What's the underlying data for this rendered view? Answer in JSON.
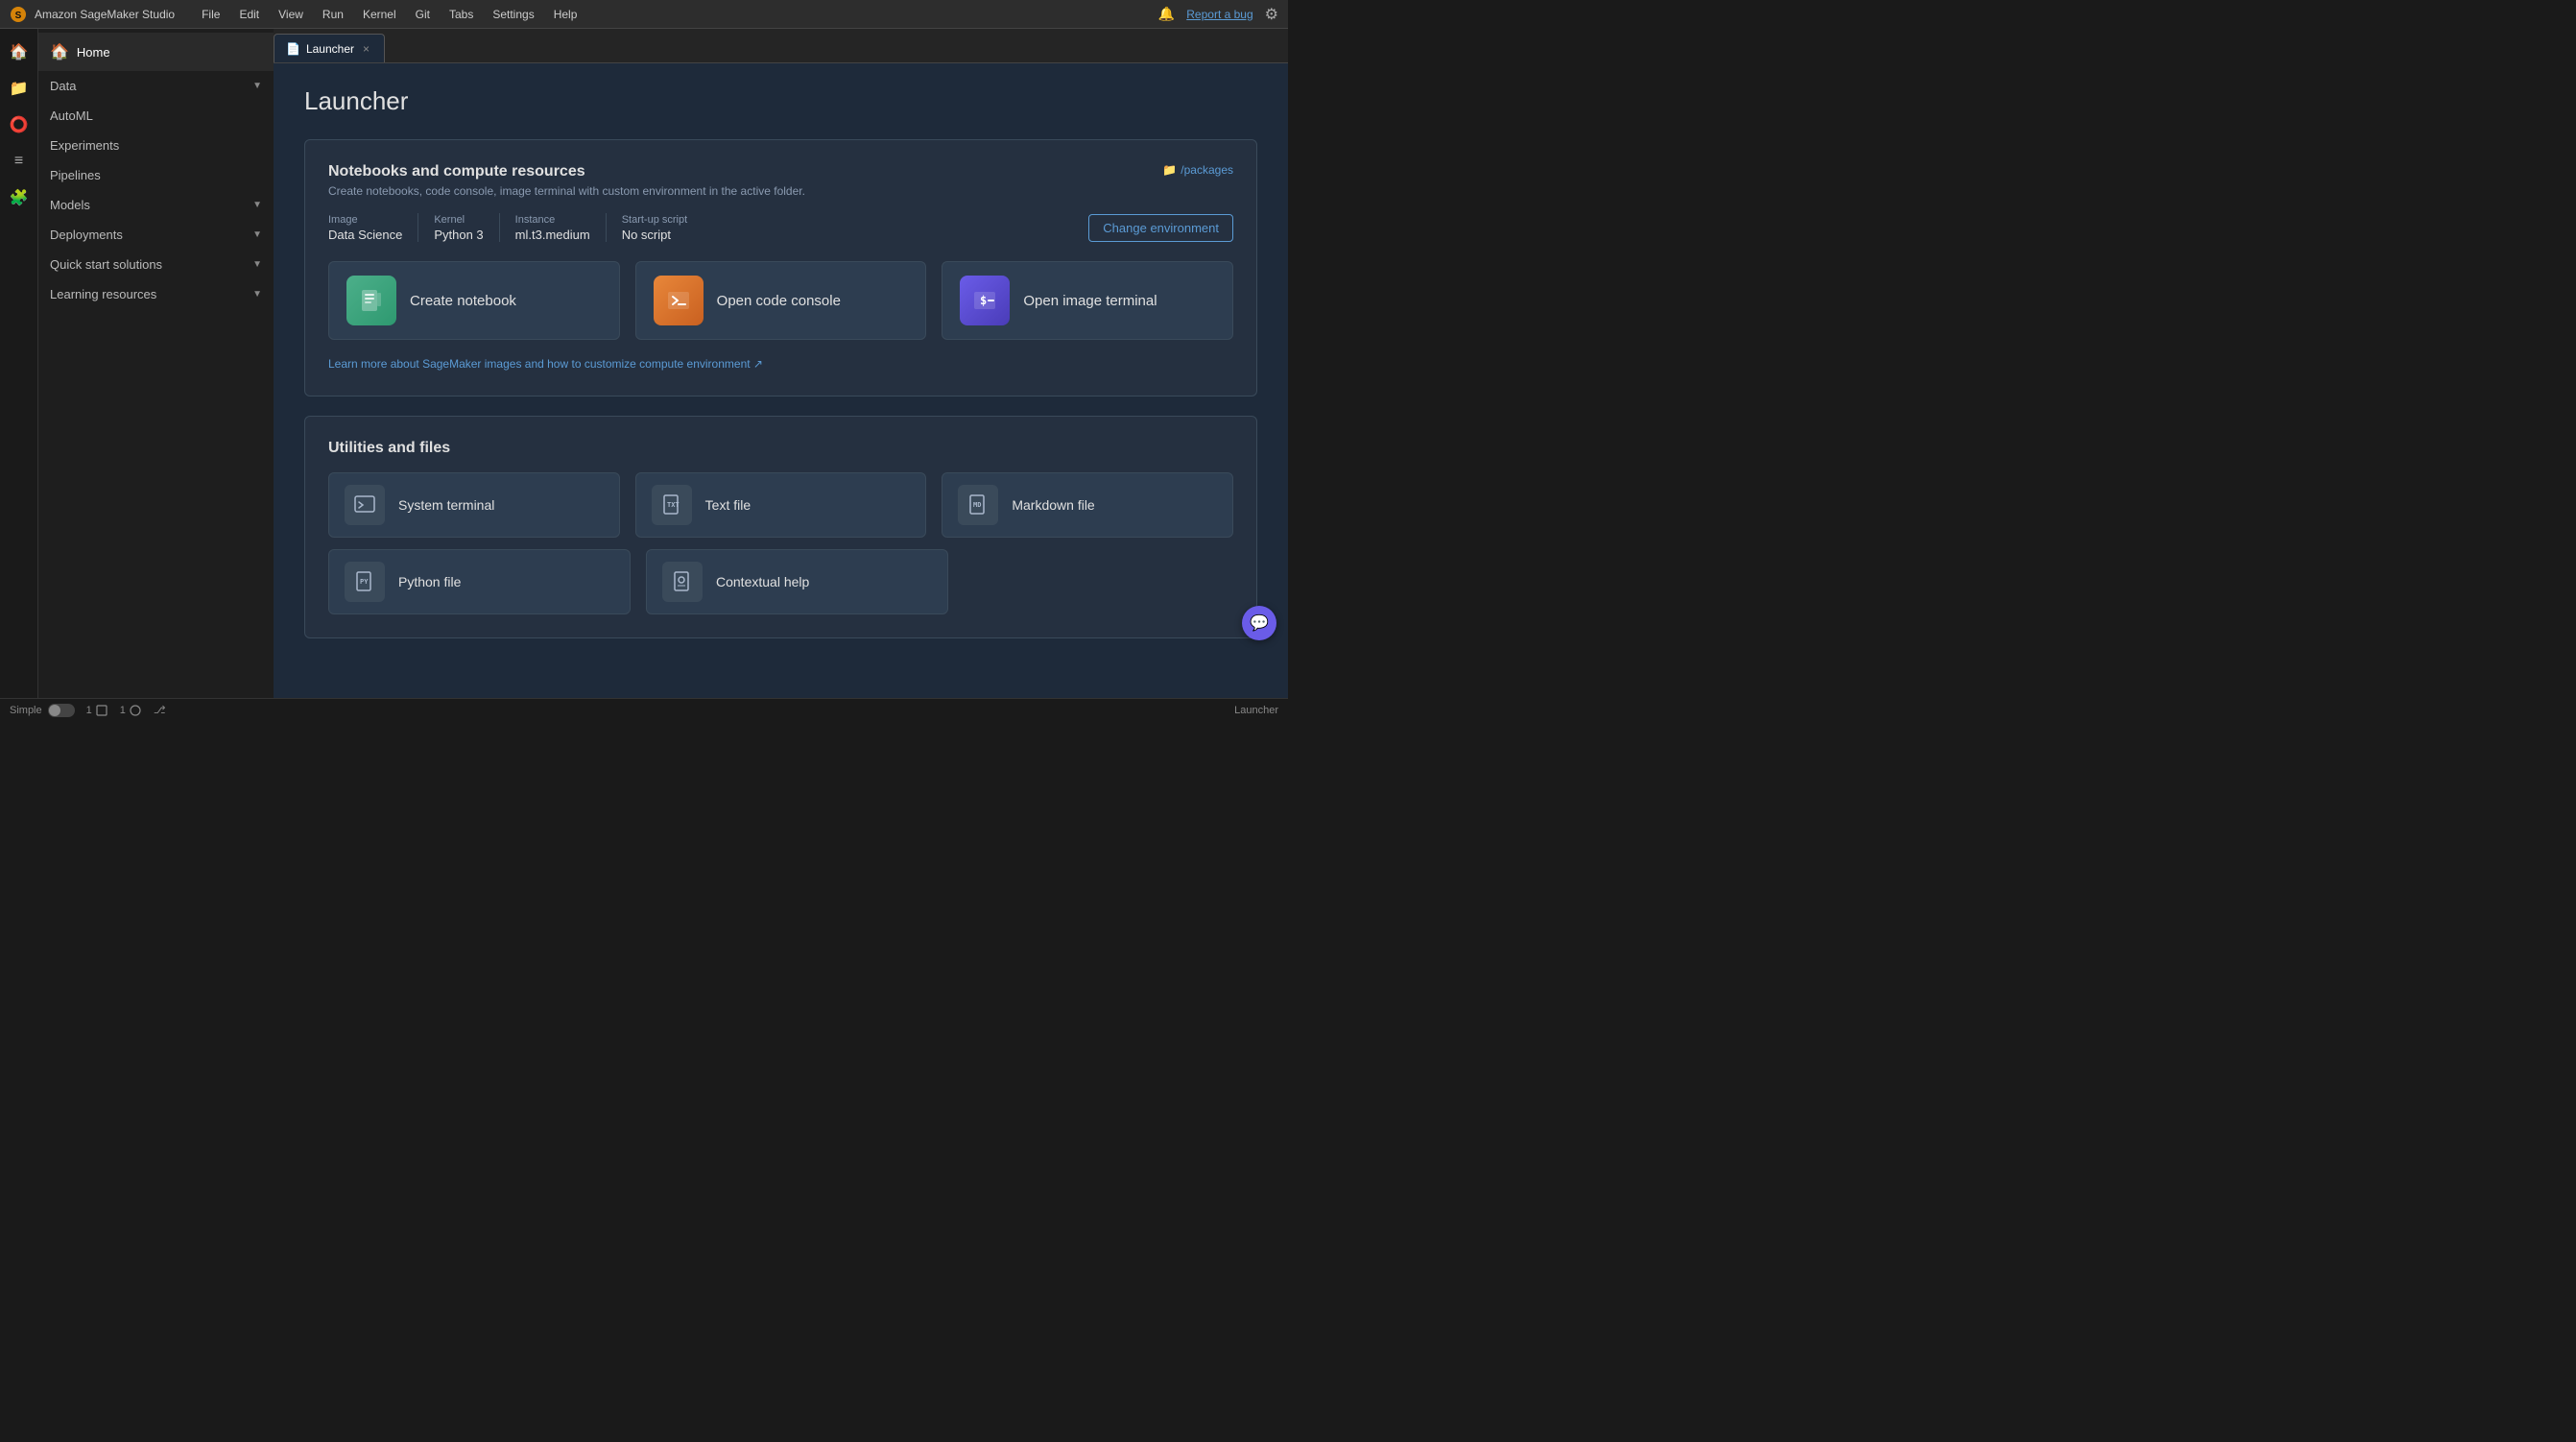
{
  "app": {
    "title": "Amazon SageMaker Studio"
  },
  "menubar": {
    "items": [
      "File",
      "Edit",
      "View",
      "Run",
      "Kernel",
      "Git",
      "Tabs",
      "Settings",
      "Help"
    ],
    "report_bug": "Report a bug"
  },
  "sidebar": {
    "home": "Home",
    "items": [
      {
        "label": "Data",
        "has_chevron": true
      },
      {
        "label": "AutoML",
        "has_chevron": false
      },
      {
        "label": "Experiments",
        "has_chevron": false
      },
      {
        "label": "Pipelines",
        "has_chevron": false
      },
      {
        "label": "Models",
        "has_chevron": true
      },
      {
        "label": "Deployments",
        "has_chevron": true
      },
      {
        "label": "Quick start solutions",
        "has_chevron": true
      },
      {
        "label": "Learning resources",
        "has_chevron": true
      }
    ]
  },
  "tab": {
    "icon": "📄",
    "label": "Launcher",
    "close": "×"
  },
  "launcher": {
    "title": "Launcher",
    "notebooks_section": {
      "title": "Notebooks and compute resources",
      "description": "Create notebooks, code console, image terminal with custom environment in the active folder.",
      "packages_link": "/packages",
      "environment": {
        "image_label": "Image",
        "image_value": "Data Science",
        "kernel_label": "Kernel",
        "kernel_value": "Python 3",
        "instance_label": "Instance",
        "instance_value": "ml.t3.medium",
        "startup_label": "Start-up script",
        "startup_value": "No script"
      },
      "change_env_btn": "Change environment",
      "actions": [
        {
          "label": "Create notebook",
          "icon": "🖼",
          "icon_class": "icon-notebook"
        },
        {
          "label": "Open code console",
          "icon": "▶",
          "icon_class": "icon-console"
        },
        {
          "label": "Open image terminal",
          "icon": "$",
          "icon_class": "icon-terminal"
        }
      ],
      "learn_link": "Learn more about SageMaker images and how to customize compute environment ↗"
    },
    "utilities_section": {
      "title": "Utilities and files",
      "items_row1": [
        {
          "label": "System terminal",
          "icon": "⬜"
        },
        {
          "label": "Text file",
          "icon": "📄"
        },
        {
          "label": "Markdown file",
          "icon": "📝"
        }
      ],
      "items_row2": [
        {
          "label": "Python file",
          "icon": "🐍"
        },
        {
          "label": "Contextual help",
          "icon": "📋"
        }
      ]
    }
  },
  "status_bar": {
    "simple_label": "Simple",
    "kernel_count": "1",
    "file_count": "1",
    "launcher_label": "Launcher"
  },
  "colors": {
    "accent_blue": "#5b9bd5",
    "notebook_gradient_start": "#4caf8a",
    "console_gradient_start": "#e8873a",
    "terminal_gradient_start": "#6a5ce8"
  }
}
